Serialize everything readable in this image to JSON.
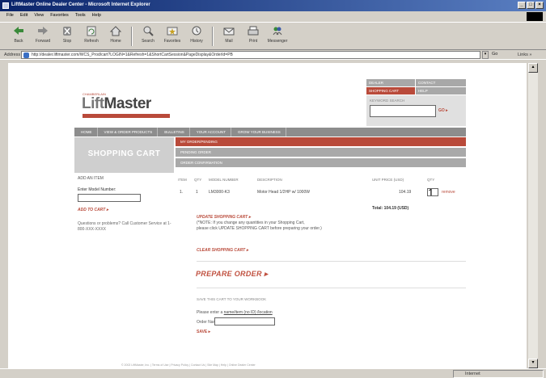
{
  "window": {
    "title": "LiftMaster Online Dealer Center - Microsoft Internet Explorer",
    "controls": [
      "_",
      "□",
      "×"
    ]
  },
  "menu": [
    "File",
    "Edit",
    "View",
    "Favorites",
    "Tools",
    "Help"
  ],
  "toolbar": [
    {
      "label": "Back",
      "icon": "back-arrow-icon"
    },
    {
      "label": "Forward",
      "icon": "forward-arrow-icon"
    },
    {
      "label": "Stop",
      "icon": "stop-icon"
    },
    {
      "label": "Refresh",
      "icon": "refresh-icon"
    },
    {
      "label": "Home",
      "icon": "home-icon"
    },
    {
      "label": "Search",
      "icon": "search-icon"
    },
    {
      "label": "Favorites",
      "icon": "favorites-icon"
    },
    {
      "label": "History",
      "icon": "history-icon"
    },
    {
      "label": "Mail",
      "icon": "mail-icon"
    },
    {
      "label": "Print",
      "icon": "print-icon"
    },
    {
      "label": "Messenger",
      "icon": "messenger-icon"
    }
  ],
  "address": {
    "label": "Address",
    "url": "http://dealer.liftmaster.com/WCS_Prod/cart?LOGIN=1&Refresh=1&ShortCartSession&PageDisplay&OrderId=PB",
    "go": "Go",
    "links": "Links »"
  },
  "page": {
    "logo_tag": "CHAMBERLAIN",
    "logo_lift": "Lift",
    "logo_master": "Master",
    "right_tabs": [
      "DEALER",
      "CONTACT",
      "SHOPPING CART",
      "HELP"
    ],
    "search_label": "KEYWORD SEARCH",
    "search_go": "GO ▸",
    "nav": [
      "HOME",
      "VIEW & ORDER PRODUCTS",
      "BULLETINS",
      "YOUR ACCOUNT",
      "GROW YOUR BUSINESS"
    ],
    "banner": "SHOPPING CART",
    "sub_bars": [
      "MY ORDER/PENDING",
      "PENDING ORDER",
      "ORDER CONFIRMATION"
    ],
    "left": {
      "add_title": "ADD AN ITEM",
      "model_label": "Enter Model Number:",
      "add_cart": "ADD TO CART ▸",
      "help": "Questions or problems? Call Customer Service at 1-800-XXX-XXXX"
    },
    "table": {
      "headers": [
        "ITEM",
        "QTY",
        "MODEL NUMBER",
        "DESCRIPTION",
        "UNIT PRICE (USD)",
        "QTY"
      ],
      "row": {
        "item": "1.",
        "qty": "1",
        "model": "LM3000-K3",
        "description": "Motor Head 1/2HP w/ 1000W",
        "price": "104.19",
        "remove": "remove"
      },
      "total": "Total: 104.19 (USD)"
    },
    "update": "UPDATE SHOPPING CART ▸",
    "note1": "(*NOTE: If you change any quantities in your Shopping Cart,",
    "note2": "please click UPDATE SHOPPING CART before preparing your order.)",
    "clear": "CLEAR SHOPPING CART ▸",
    "checkout": "PREPARE ORDER ▸",
    "save_title": "SAVE THIS CART TO YOUR WORKBOOK",
    "save_note_prefix": "Please enter a ",
    "save_note_link": "name/item (no ID) /location",
    "order_label": "Order Name",
    "save_btn": "SAVE ▸",
    "footer": "© 2002 LiftMaster, Inc. | Terms of Use | Privacy Policy | Contact Us | Site Map | Help | Online Dealer Center"
  },
  "status": {
    "zone": "Internet"
  }
}
